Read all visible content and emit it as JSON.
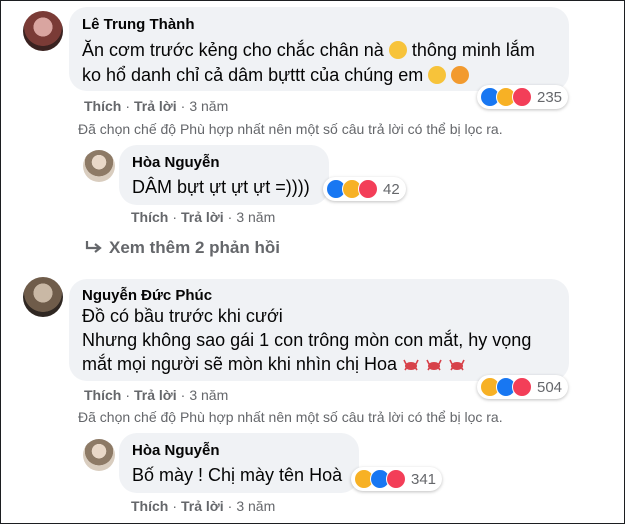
{
  "comments": [
    {
      "author": "Lê Trung Thành",
      "line1_a": "Ăn cơm trước kẻng cho chắc chân nà",
      "line1_b": "thông minh lắm",
      "line2": "ko hổ danh chỉ cả dâm bựttt của chúng em",
      "like": "Thích",
      "reply": "Trả lời",
      "time": "3 năm",
      "reaction_count": "235",
      "filter_note": "Đã chọn chế độ Phù hợp nhất nên một số câu trả lời có thể bị lọc ra."
    },
    {
      "author": "Hòa Nguyễn",
      "line1": "DÂM bựt ựt ựt ựt =))))",
      "like": "Thích",
      "reply": "Trả lời",
      "time": "3 năm",
      "reaction_count": "42"
    },
    {
      "author": "Nguyễn Đức Phúc",
      "line1": "Đồ có bầu trước khi cưới",
      "line2": "Nhưng không sao gái 1 con trông mòn con mắt, hy vọng",
      "line3": "mắt mọi người sẽ mòn khi nhìn chị Hoa",
      "like": "Thích",
      "reply": "Trả lời",
      "time": "3 năm",
      "reaction_count": "504",
      "filter_note": "Đã chọn chế độ Phù hợp nhất nên một số câu trả lời có thể bị lọc ra."
    },
    {
      "author": "Hòa Nguyễn",
      "line1": "Bố mày ! Chị mày tên Hoà",
      "like": "Thích",
      "reply": "Trả lời",
      "time": "3 năm",
      "reaction_count": "341"
    }
  ],
  "more_replies": "Xem thêm 2 phản hồi",
  "colors": {
    "bubble": "#f0f2f5",
    "meta": "#65676b",
    "like": "#1877f2",
    "haha": "#f7b125",
    "love": "#f33e58"
  },
  "icons": [
    "reply-arrow-icon",
    "like-icon",
    "haha-icon",
    "love-icon",
    "grin-emoji-icon",
    "smile-emoji-icon",
    "kiss-emoji-icon",
    "crab-icon"
  ]
}
